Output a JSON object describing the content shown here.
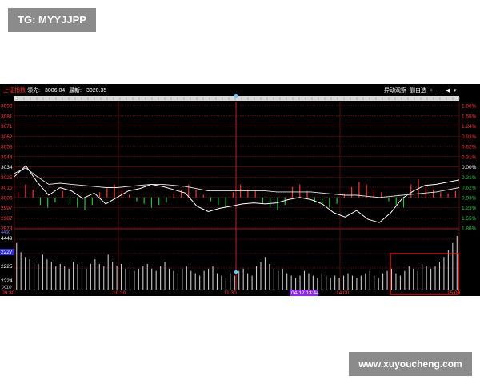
{
  "watermarks": {
    "top_left": "TG: MYYJJPP",
    "bottom_right": "www.xuyoucheng.com"
  },
  "chart_data": {
    "type": "line",
    "title": "上证指数",
    "info": {
      "prev_label": "领先:",
      "prev_value": "3006.04",
      "last_label": "最新:",
      "last_value": "3020.35"
    },
    "toolbar": [
      "异动观察",
      "删自选",
      "+",
      "−",
      "◀",
      "▾"
    ],
    "prev_close": 3006.04,
    "price_axis": [
      "3090",
      "3081",
      "3071",
      "3062",
      "3053",
      "3044",
      "3034",
      "3025",
      "3015",
      "3006",
      "2997",
      "2987",
      "2978"
    ],
    "pct_axis": [
      "1.86%",
      "1.55%",
      "1.24%",
      "0.93%",
      "0.62%",
      "0.31%",
      "0.00%",
      "0.31%",
      "0.62%",
      "0.93%",
      "1.23%",
      "1.55%",
      "1.86%"
    ],
    "volume_axis": [
      "4449",
      "2227",
      "2225",
      "2224"
    ],
    "volume_axis_top": "4460",
    "volume_unit": "X10",
    "time_axis": [
      "09:30",
      "10:30",
      "11:30",
      "14:00",
      "15:00"
    ],
    "cursor_label": "04-12 13:44",
    "series": [
      {
        "values": [
          3025,
          3035,
          3020,
          3008,
          3015,
          3012,
          3005,
          3010,
          3000,
          3006,
          3012,
          3014,
          3018,
          3016,
          3013,
          3010,
          2998,
          2993,
          2996,
          2998,
          3000,
          3001,
          3000,
          3001,
          3004,
          3006,
          3004,
          3000,
          2992,
          2988,
          2994,
          2986,
          2983,
          2992,
          3005,
          3012,
          3017,
          3018,
          3020,
          3022
        ]
      },
      {
        "values": [
          3028,
          3033,
          3025,
          3018,
          3019,
          3018,
          3017,
          3016,
          3015,
          3015,
          3016,
          3017,
          3018,
          3018,
          3017,
          3016,
          3014,
          3012,
          3012,
          3012,
          3012,
          3012,
          3012,
          3011,
          3011,
          3011,
          3011,
          3010,
          3009,
          3008,
          3008,
          3007,
          3006,
          3007,
          3008,
          3009,
          3010,
          3011,
          3013,
          3015
        ]
      }
    ],
    "diff_bars": [
      4,
      10,
      6,
      -6,
      -8,
      -4,
      5,
      -5,
      -8,
      -10,
      -6,
      4,
      8,
      10,
      6,
      2,
      -3,
      -5,
      -8,
      -6,
      -4,
      3,
      6,
      10,
      6,
      2,
      -3,
      -6,
      -8,
      4,
      10,
      6,
      5,
      -5,
      -8,
      -10,
      -6,
      8,
      10,
      5,
      -4,
      -6,
      -8,
      -5,
      3,
      8,
      12,
      10,
      6,
      4,
      -3,
      -6,
      -8,
      10,
      14,
      8,
      6,
      4,
      3,
      5
    ],
    "volume": [
      40,
      32,
      28,
      26,
      24,
      22,
      30,
      26,
      24,
      20,
      22,
      20,
      18,
      24,
      22,
      20,
      18,
      22,
      26,
      22,
      20,
      30,
      24,
      20,
      22,
      18,
      20,
      16,
      18,
      20,
      22,
      18,
      16,
      20,
      24,
      18,
      16,
      14,
      18,
      20,
      16,
      14,
      12,
      16,
      18,
      20,
      14,
      12,
      10,
      14,
      12,
      16,
      18,
      14,
      12,
      20,
      24,
      28,
      22,
      18,
      16,
      18,
      14,
      12,
      10,
      12,
      16,
      14,
      12,
      10,
      14,
      12,
      10,
      12,
      10,
      12,
      14,
      12,
      10,
      12,
      14,
      16,
      12,
      10,
      14,
      16,
      18,
      14,
      12,
      16,
      20,
      18,
      16,
      22,
      20,
      18,
      20,
      24,
      28,
      34,
      40,
      46
    ],
    "colors": {
      "background": "#000000",
      "grid": "#8a1414",
      "up": "#ff3232",
      "down": "#22c83a",
      "price_line": "#ffffff",
      "avg_line": "#e8e8e8",
      "volume": "#c8c8c8",
      "axis_text": "#ff4040",
      "time_text": "#ff4040",
      "cursor_bg": "#8a2be2",
      "highlight_box": "#ff2020"
    },
    "highlight_box": "15:00 region"
  }
}
